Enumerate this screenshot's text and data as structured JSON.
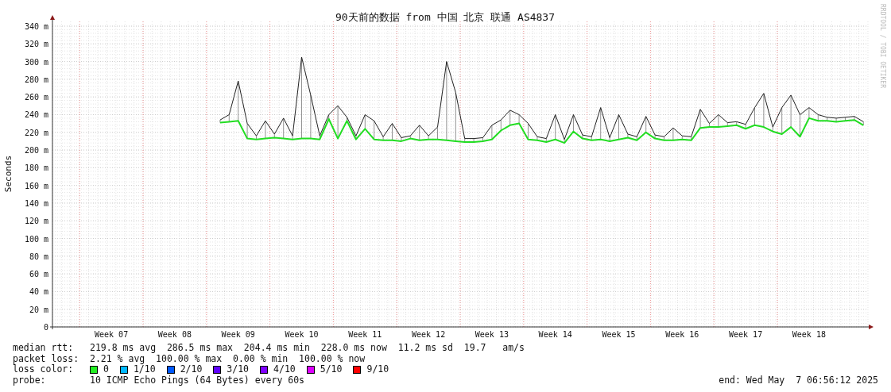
{
  "graph": {
    "credit": "RRDTOOL / TOBI OETIKER",
    "chart_data": {
      "type": "line",
      "title": "90天前的数据 from 中国 北京 联通 AS4837",
      "ylabel": "Seconds",
      "grid": true,
      "ylim": [
        0,
        340
      ],
      "categories": [
        null,
        null,
        null,
        null,
        null,
        null,
        "Week 07",
        null,
        null,
        null,
        null,
        null,
        null,
        "Week 08",
        null,
        null,
        null,
        null,
        null,
        null,
        "Week 09",
        null,
        null,
        null,
        null,
        null,
        null,
        "Week 10",
        null,
        null,
        null,
        null,
        null,
        null,
        "Week 11",
        null,
        null,
        null,
        null,
        null,
        null,
        "Week 12",
        null,
        null,
        null,
        null,
        null,
        null,
        "Week 13",
        null,
        null,
        null,
        null,
        null,
        null,
        "Week 14",
        null,
        null,
        null,
        null,
        null,
        null,
        "Week 15",
        null,
        null,
        null,
        null,
        null,
        null,
        "Week 16",
        null,
        null,
        null,
        null,
        null,
        null,
        "Week 17",
        null,
        null,
        null,
        null,
        null,
        null,
        "Week 18",
        null,
        null,
        null,
        null,
        null,
        null
      ],
      "yticks": [
        {
          "value": 0,
          "label": "0"
        },
        {
          "value": 20,
          "label": "20 m"
        },
        {
          "value": 40,
          "label": "40 m"
        },
        {
          "value": 60,
          "label": "60 m"
        },
        {
          "value": 80,
          "label": "80 m"
        },
        {
          "value": 100,
          "label": "100 m"
        },
        {
          "value": 120,
          "label": "120 m"
        },
        {
          "value": 140,
          "label": "140 m"
        },
        {
          "value": 160,
          "label": "160 m"
        },
        {
          "value": 180,
          "label": "180 m"
        },
        {
          "value": 200,
          "label": "200 m"
        },
        {
          "value": 220,
          "label": "220 m"
        },
        {
          "value": 240,
          "label": "240 m"
        },
        {
          "value": 260,
          "label": "260 m"
        },
        {
          "value": 280,
          "label": "280 m"
        },
        {
          "value": 300,
          "label": "300 m"
        },
        {
          "value": 320,
          "label": "320 m"
        },
        {
          "value": 340,
          "label": "340 m"
        }
      ],
      "series": [
        {
          "color": "#222222",
          "values": [
            null,
            null,
            null,
            null,
            null,
            null,
            null,
            null,
            null,
            null,
            null,
            null,
            null,
            null,
            null,
            null,
            null,
            null,
            234,
            240,
            278,
            230,
            216,
            233,
            218,
            236,
            216,
            305,
            262,
            216,
            240,
            250,
            237,
            216,
            240,
            233,
            215,
            230,
            214,
            216,
            228,
            216,
            226,
            300,
            265,
            213,
            213,
            214,
            228,
            234,
            245,
            240,
            230,
            215,
            213,
            240,
            212,
            240,
            217,
            215,
            248,
            214,
            240,
            218,
            215,
            238,
            217,
            215,
            225,
            216,
            215,
            246,
            230,
            240,
            231,
            232,
            229,
            248,
            264,
            226,
            248,
            262,
            240,
            248,
            240,
            237,
            236,
            237,
            238,
            232
          ]
        },
        {
          "color": "#22dd22",
          "values": [
            null,
            null,
            null,
            null,
            null,
            null,
            null,
            null,
            null,
            null,
            null,
            null,
            null,
            null,
            null,
            null,
            null,
            null,
            231,
            232,
            233,
            213,
            212,
            213,
            214,
            213,
            212,
            213,
            213,
            212,
            235,
            213,
            233,
            212,
            224,
            212,
            211,
            211,
            210,
            213,
            211,
            212,
            212,
            211,
            210,
            209,
            209,
            210,
            212,
            222,
            228,
            230,
            212,
            211,
            209,
            212,
            208,
            221,
            213,
            211,
            212,
            210,
            212,
            214,
            211,
            220,
            213,
            211,
            211,
            212,
            211,
            225,
            226,
            226,
            227,
            228,
            224,
            228,
            226,
            221,
            218,
            226,
            215,
            236,
            233,
            233,
            232,
            233,
            234,
            228
          ]
        }
      ]
    }
  },
  "legend": {
    "median_rtt": {
      "label": "median rtt:",
      "value": "219.8 ms avg  286.5 ms max  204.4 ms min  228.0 ms now  11.2 ms sd  19.7   am/s"
    },
    "packet_loss": {
      "label": "packet loss:",
      "value": "2.21 % avg  100.00 % max  0.00 % min  100.00 % now"
    },
    "loss_color": {
      "label": "loss color:",
      "items": [
        {
          "label": "0",
          "color": "#22ee22"
        },
        {
          "label": "1/10",
          "color": "#00b8ff"
        },
        {
          "label": "2/10",
          "color": "#0059ff"
        },
        {
          "label": "3/10",
          "color": "#5e00ff"
        },
        {
          "label": "4/10",
          "color": "#7e00ff"
        },
        {
          "label": "5/10",
          "color": "#dd00ff"
        },
        {
          "label": "9/10",
          "color": "#ff0000"
        }
      ]
    },
    "probe": {
      "label": "probe:",
      "value": "10 ICMP Echo Pings (64 Bytes) every 60s"
    },
    "end": "end: Wed May  7 06:56:12 2025"
  }
}
